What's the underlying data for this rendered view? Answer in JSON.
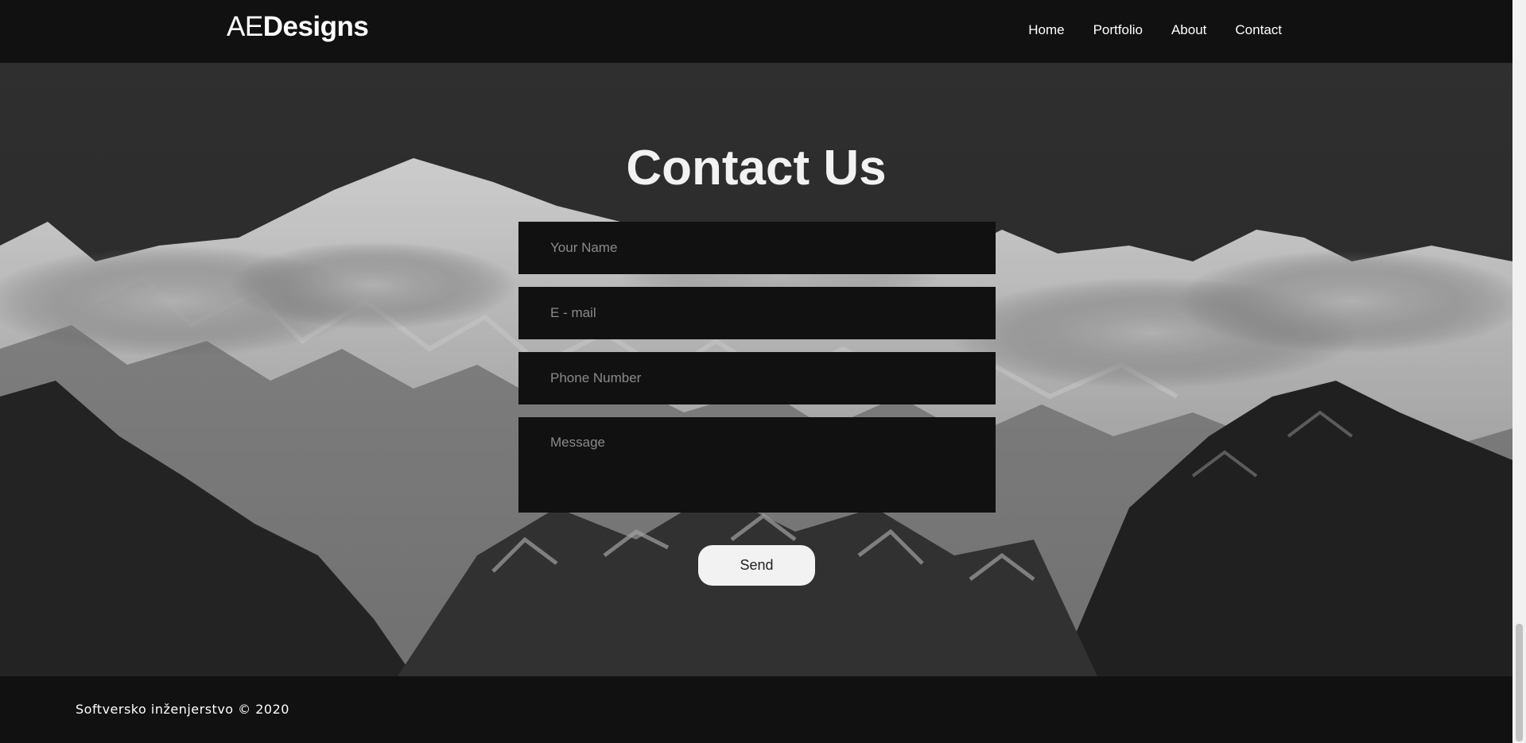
{
  "header": {
    "logo_light": "AE",
    "logo_bold": "Designs",
    "nav": [
      {
        "label": "Home"
      },
      {
        "label": "Portfolio"
      },
      {
        "label": "About"
      },
      {
        "label": "Contact"
      }
    ]
  },
  "main": {
    "title": "Contact Us",
    "fields": {
      "name_placeholder": "Your Name",
      "email_placeholder": "E - mail",
      "phone_placeholder": "Phone Number",
      "message_placeholder": "Message"
    },
    "send_label": "Send",
    "background_image": "snowy-mountains-grayscale"
  },
  "footer": {
    "text": "Softversko inženjerstvo © 2020"
  },
  "colors": {
    "navbar_bg": "#111111",
    "field_bg": "#111111",
    "button_bg": "#f2f2f2",
    "title_color": "#f2f2f2"
  }
}
